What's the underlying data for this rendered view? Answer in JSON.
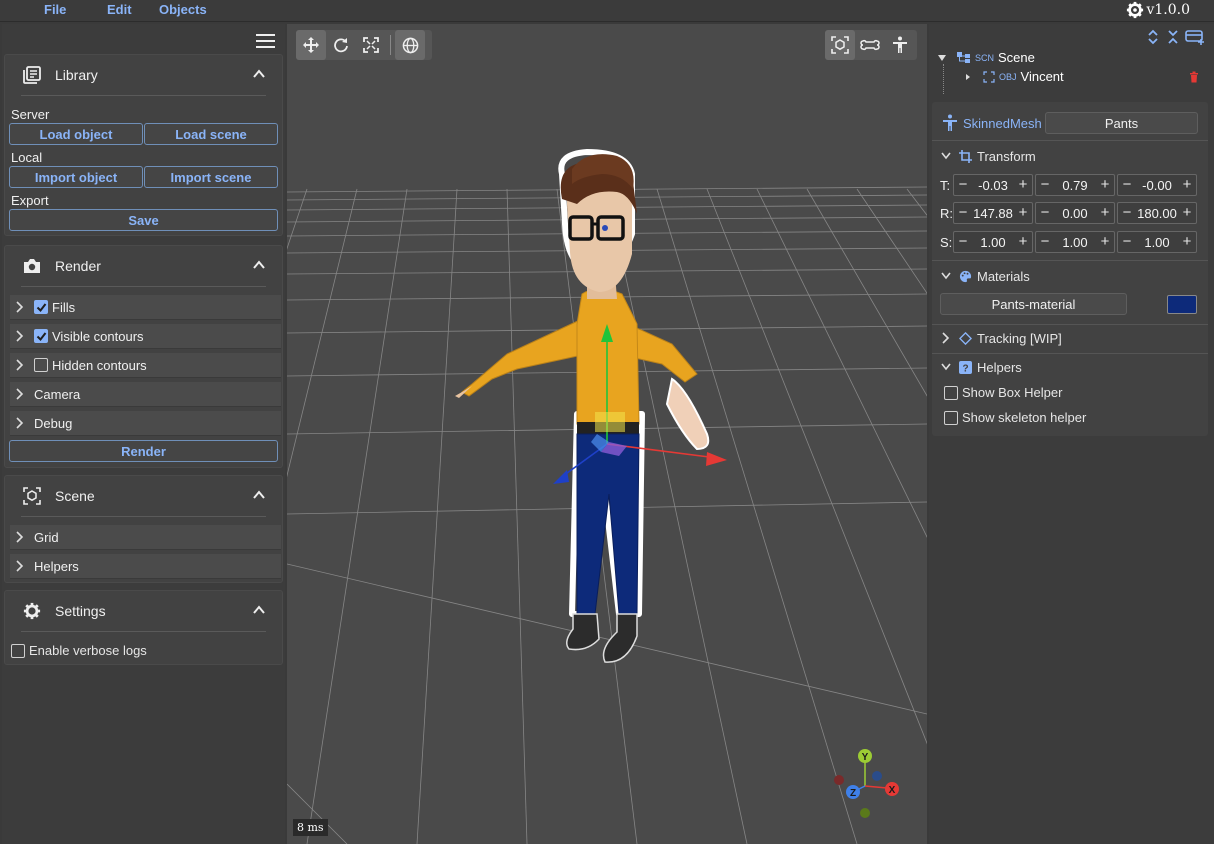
{
  "menu": {
    "file": "File",
    "edit": "Edit",
    "objects": "Objects"
  },
  "version": "v1.0.0",
  "library": {
    "title": "Library",
    "server_label": "Server",
    "load_object": "Load object",
    "load_scene": "Load scene",
    "local_label": "Local",
    "import_object": "Import object",
    "import_scene": "Import scene",
    "export_label": "Export",
    "save": "Save"
  },
  "render": {
    "title": "Render",
    "items": [
      {
        "label": "Fills",
        "checkbox": true,
        "checked": true
      },
      {
        "label": "Visible contours",
        "checkbox": true,
        "checked": true
      },
      {
        "label": "Hidden contours",
        "checkbox": true,
        "checked": false
      },
      {
        "label": "Camera",
        "checkbox": false
      },
      {
        "label": "Debug",
        "checkbox": false
      }
    ],
    "render_button": "Render"
  },
  "scene_panel": {
    "title": "Scene",
    "items": [
      "Grid",
      "Helpers"
    ]
  },
  "settings": {
    "title": "Settings",
    "verbose_logs": "Enable verbose logs",
    "verbose_checked": false
  },
  "viewport": {
    "frame_time": "8 ms",
    "axes": {
      "y": "Y",
      "x": "X",
      "z": "Z"
    }
  },
  "tree": {
    "scene_tag": "SCN",
    "scene_name": "Scene",
    "obj_tag": "OBJ",
    "obj_name": "Vincent"
  },
  "inspector": {
    "type": "SkinnedMesh",
    "name": "Pants",
    "transform_title": "Transform",
    "t_label": "T:",
    "r_label": "R:",
    "s_label": "S:",
    "t": [
      "-0.03",
      "0.79",
      "-0.00"
    ],
    "r": [
      "147.88",
      "0.00",
      "180.00"
    ],
    "s": [
      "1.00",
      "1.00",
      "1.00"
    ],
    "materials_title": "Materials",
    "material_name": "Pants-material",
    "material_color": "#0d2a7a",
    "tracking_title": "Tracking [WIP]",
    "helpers_title": "Helpers",
    "show_box_helper": "Show Box Helper",
    "show_skeleton_helper": "Show skeleton helper"
  },
  "colors": {
    "accent": "#8ab4f8",
    "x_axis": "#e53935",
    "y_axis": "#43a047",
    "z_axis": "#1e40c8"
  }
}
